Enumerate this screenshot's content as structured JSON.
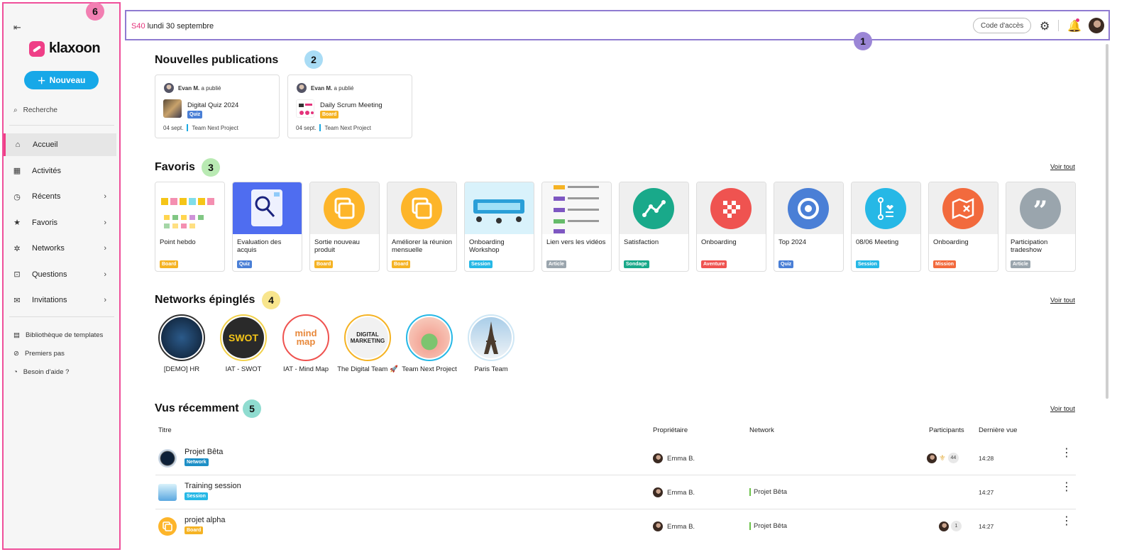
{
  "sidebar": {
    "brand": "klaxoon",
    "new_label": "Nouveau",
    "search_label": "Recherche",
    "nav": [
      {
        "label": "Accueil",
        "icon": "home-icon"
      },
      {
        "label": "Activités",
        "icon": "grid-icon"
      },
      {
        "label": "Récents",
        "icon": "clock-icon"
      },
      {
        "label": "Favoris",
        "icon": "star-icon"
      },
      {
        "label": "Networks",
        "icon": "network-icon"
      },
      {
        "label": "Questions",
        "icon": "inbox-icon"
      },
      {
        "label": "Invitations",
        "icon": "mail-icon"
      }
    ],
    "bottom": [
      "Bibliothèque de templates",
      "Premiers pas",
      "Besoin d'aide ?"
    ]
  },
  "markers": [
    "1",
    "2",
    "3",
    "4",
    "5",
    "6"
  ],
  "topbar": {
    "week": "S40",
    "date": "lundi 30 septembre",
    "code_label": "Code d'accès"
  },
  "publications": {
    "title": "Nouvelles publications",
    "items": [
      {
        "author": "Evan M.",
        "action": "a publié",
        "title": "Digital Quiz 2024",
        "type": "Quiz",
        "date": "04 sept.",
        "team": "Team Next Project"
      },
      {
        "author": "Evan M.",
        "action": "a publié",
        "title": "Daily Scrum Meeting",
        "type": "Board",
        "date": "04 sept.",
        "team": "Team Next Project"
      }
    ]
  },
  "favorites": {
    "title": "Favoris",
    "see_all": "Voir tout",
    "items": [
      {
        "label": "Point hebdo",
        "type": "Board"
      },
      {
        "label": "Evaluation des acquis",
        "type": "Quiz"
      },
      {
        "label": "Sortie nouveau produit",
        "type": "Board"
      },
      {
        "label": "Améliorer la réunion mensuelle",
        "type": "Board"
      },
      {
        "label": "Onboarding Workshop",
        "type": "Session"
      },
      {
        "label": "Lien vers les vidéos",
        "type": "Article"
      },
      {
        "label": "Satisfaction",
        "type": "Sondage"
      },
      {
        "label": "Onboarding",
        "type": "Aventure"
      },
      {
        "label": "Top 2024",
        "type": "Quiz"
      },
      {
        "label": "08/06 Meeting",
        "type": "Session"
      },
      {
        "label": "Onboarding",
        "type": "Mission"
      },
      {
        "label": "Participation tradeshow",
        "type": "Article"
      }
    ]
  },
  "networks": {
    "title": "Networks épinglés",
    "see_all": "Voir tout",
    "items": [
      {
        "name": "[DEMO] HR",
        "logo": ""
      },
      {
        "name": "IAT - SWOT",
        "logo": "SWOT"
      },
      {
        "name": "IAT - Mind Map",
        "logo": "mind map"
      },
      {
        "name": "The Digital Team 🚀",
        "logo": "DIGITAL MARKETING"
      },
      {
        "name": "Team Next Project",
        "logo": ""
      },
      {
        "name": "Paris Team",
        "logo": ""
      }
    ]
  },
  "recent": {
    "title": "Vus récemment",
    "see_all": "Voir tout",
    "columns": {
      "title": "Titre",
      "owner": "Propriétaire",
      "network": "Network",
      "participants": "Participants",
      "last_seen": "Dernière vue"
    },
    "rows": [
      {
        "title": "Projet Bêta",
        "type": "Network",
        "owner": "Emma B.",
        "network": "",
        "participants": "44",
        "time": "14:28"
      },
      {
        "title": "Training session",
        "type": "Session",
        "owner": "Emma B.",
        "network": "Projet Bêta",
        "participants": "",
        "time": "14:27"
      },
      {
        "title": "projet alpha",
        "type": "Board",
        "owner": "Emma B.",
        "network": "Projet Bêta",
        "participants": "1",
        "time": "14:27"
      }
    ]
  },
  "colors": {
    "Board": "#f5b324",
    "Quiz": "#4a7fd6",
    "Session": "#26b8e6",
    "Article": "#9aa5ad",
    "Sondage": "#19a98a",
    "Aventure": "#ef5350",
    "Mission": "#f26a3d",
    "Network": "#1d8fc6"
  }
}
